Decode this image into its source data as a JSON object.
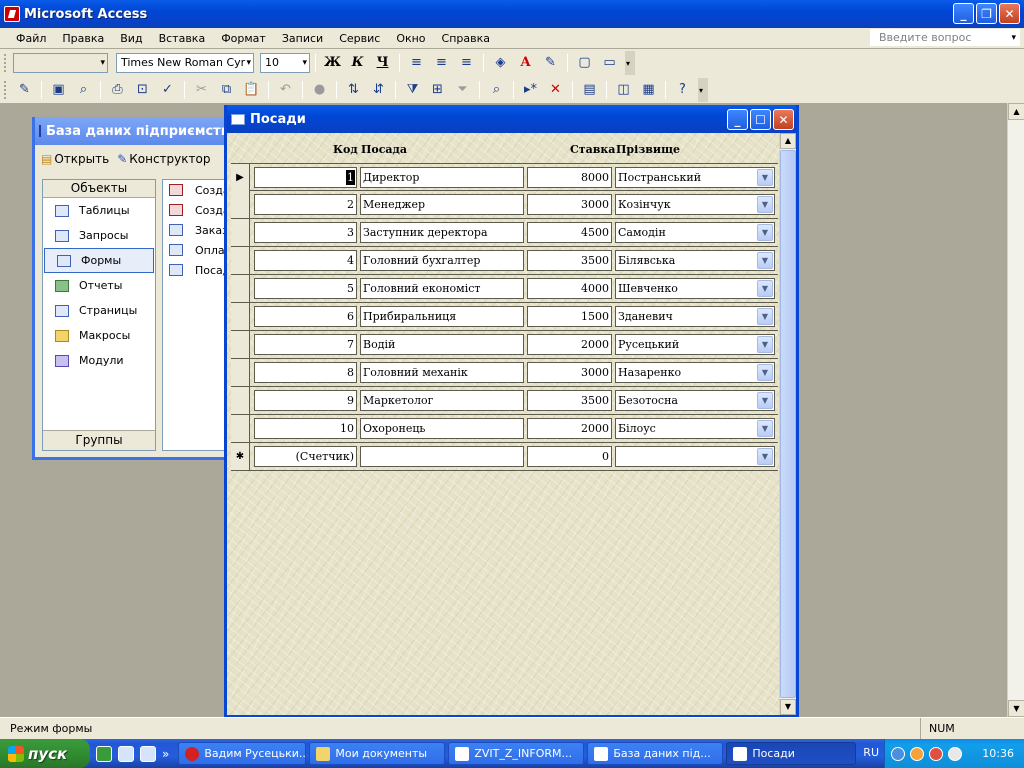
{
  "app": {
    "title": "Microsoft Access"
  },
  "menu": [
    "Файл",
    "Правка",
    "Вид",
    "Вставка",
    "Формат",
    "Записи",
    "Сервис",
    "Окно",
    "Справка"
  ],
  "ask_placeholder": "Введите вопрос",
  "font_toolbar": {
    "object_combo": "",
    "font_name": "Times New Roman Cyr",
    "font_size": "10",
    "bold": "Ж",
    "italic": "К",
    "underline": "Ч"
  },
  "db_window": {
    "title": "База даних підприємства : база",
    "open": "Открыть",
    "design": "Конструктор",
    "objects_header": "Объекты",
    "groups_footer": "Группы",
    "objects": [
      "Таблицы",
      "Запросы",
      "Формы",
      "Отчеты",
      "Страницы",
      "Макросы",
      "Модули"
    ],
    "list": [
      "Созда",
      "Созда",
      "Заказ",
      "Оплат",
      "Посад"
    ]
  },
  "form": {
    "title": "Посади",
    "headers": {
      "kod": "Код",
      "posada": "Посада",
      "stavka": "Ставка",
      "prizv": "Прізвище"
    },
    "rows": [
      {
        "kod": "1",
        "posada": "Директор",
        "stavka": "8000",
        "prizv": "Постранський"
      },
      {
        "kod": "2",
        "posada": "Менеджер",
        "stavka": "3000",
        "prizv": "Козінчук"
      },
      {
        "kod": "3",
        "posada": "Заступник деректора",
        "stavka": "4500",
        "prizv": "Самодін"
      },
      {
        "kod": "4",
        "posada": "Головний бухгалтер",
        "stavka": "3500",
        "prizv": "Білявська"
      },
      {
        "kod": "5",
        "posada": "Головний економіст",
        "stavka": "4000",
        "prizv": "Шевченко"
      },
      {
        "kod": "6",
        "posada": "Прибиральниця",
        "stavka": "1500",
        "prizv": "Зданевич"
      },
      {
        "kod": "7",
        "posada": "Водій",
        "stavka": "2000",
        "prizv": "Русецький"
      },
      {
        "kod": "8",
        "posada": "Головний механік",
        "stavka": "3000",
        "prizv": "Назаренко"
      },
      {
        "kod": "9",
        "posada": "Маркетолог",
        "stavka": "3500",
        "prizv": "Безотосна"
      },
      {
        "kod": "10",
        "posada": "Охоронець",
        "stavka": "2000",
        "prizv": "Білоус"
      }
    ],
    "new_row": {
      "kod": "(Счетчик)",
      "posada": "",
      "stavka": "0",
      "prizv": ""
    }
  },
  "status": {
    "text": "Режим формы",
    "num": "NUM"
  },
  "taskbar": {
    "start": "пуск",
    "tasks": [
      {
        "label": "Вадим Русецьки...",
        "active": false
      },
      {
        "label": "Мои документы",
        "active": false
      },
      {
        "label": "ZVIT_Z_INFORM...",
        "active": false
      },
      {
        "label": "База даних під...",
        "active": false
      },
      {
        "label": "Посади",
        "active": true
      }
    ],
    "lang": "RU",
    "clock": "10:36"
  }
}
